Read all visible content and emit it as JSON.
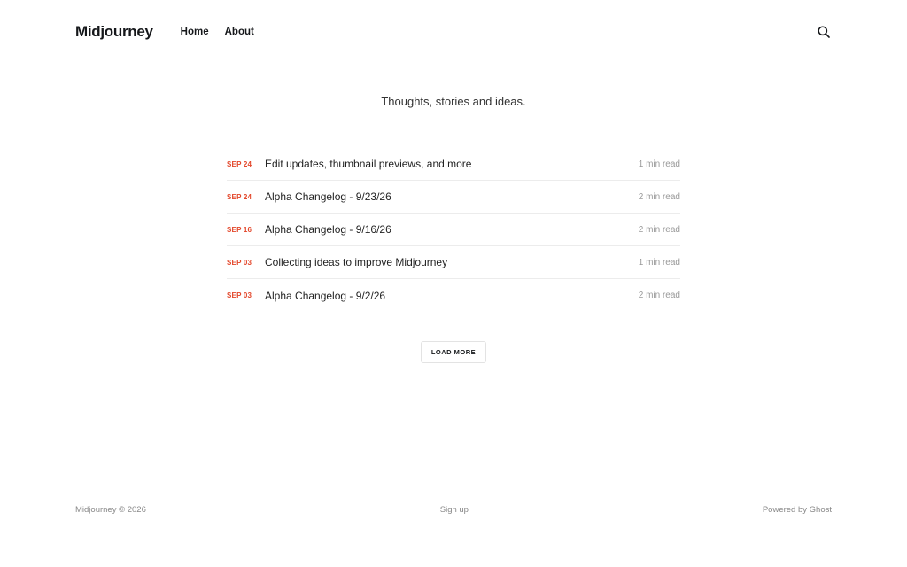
{
  "header": {
    "logo": "Midjourney",
    "nav": [
      {
        "label": "Home"
      },
      {
        "label": "About"
      }
    ],
    "search_icon": "search-icon"
  },
  "tagline": "Thoughts, stories and ideas.",
  "posts": [
    {
      "date": "SEP 24",
      "title": "Edit updates, thumbnail previews, and more",
      "read_time": "1 min read"
    },
    {
      "date": "SEP 24",
      "title": "Alpha Changelog - 9/23/26",
      "read_time": "2 min read"
    },
    {
      "date": "SEP 16",
      "title": "Alpha Changelog - 9/16/26",
      "read_time": "2 min read"
    },
    {
      "date": "SEP 03",
      "title": "Collecting ideas to improve Midjourney",
      "read_time": "1 min read"
    },
    {
      "date": "SEP 03",
      "title": "Alpha Changelog - 9/2/26",
      "read_time": "2 min read"
    }
  ],
  "load_more_label": "LOAD MORE",
  "footer": {
    "copyright": "Midjourney © 2026",
    "signup": "Sign up",
    "powered": "Powered by Ghost"
  },
  "colors": {
    "date_accent": "#e3472b",
    "text": "#15171a",
    "muted": "#999999"
  }
}
